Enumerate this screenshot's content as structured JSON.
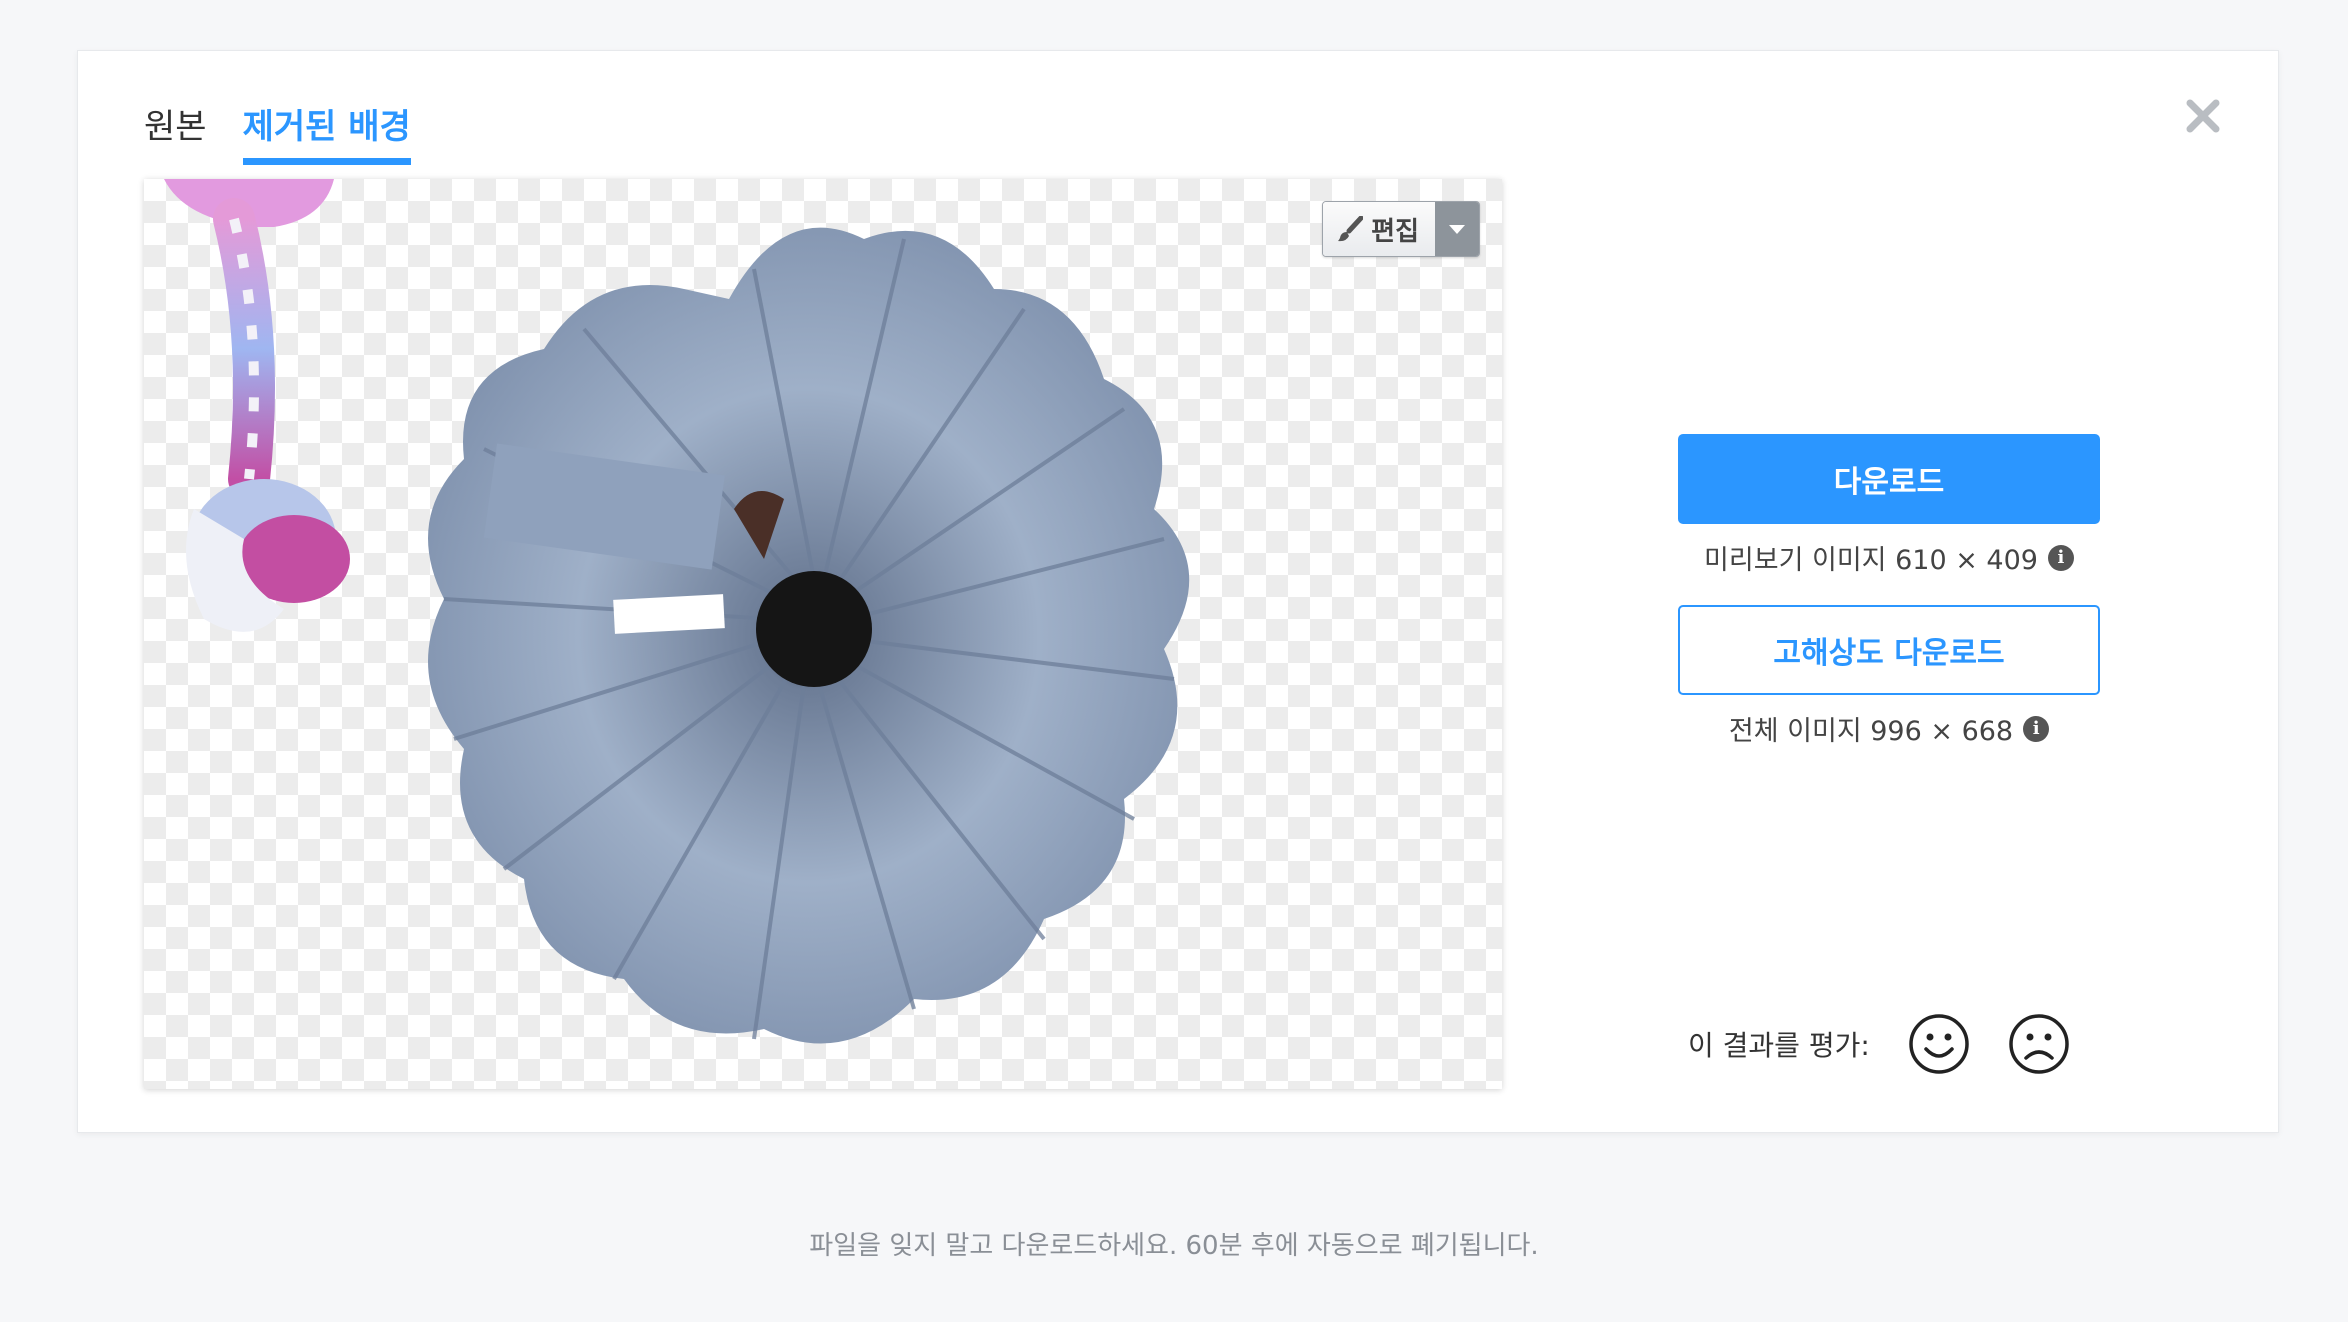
{
  "tabs": [
    {
      "label": "원본",
      "active": false
    },
    {
      "label": "제거된 배경",
      "active": true
    }
  ],
  "toolbar": {
    "edit_label": "편집"
  },
  "actions": {
    "download_label": "다운로드",
    "preview_info": "미리보기 이미지 610 × 409",
    "hd_download_label": "고해상도 다운로드",
    "full_info": "전체 이미지 996 × 668"
  },
  "rating": {
    "label": "이 결과를 평가:"
  },
  "footer": {
    "notice": "파일을 잊지 말고 다운로드하세요. 60분 후에 자동으로 폐기됩니다."
  },
  "colors": {
    "accent": "#2b96ff",
    "background": "#f6f7f9"
  },
  "icons": [
    "close-icon",
    "brush-icon",
    "caret-down-icon",
    "info-icon",
    "smile-icon",
    "frown-icon"
  ]
}
